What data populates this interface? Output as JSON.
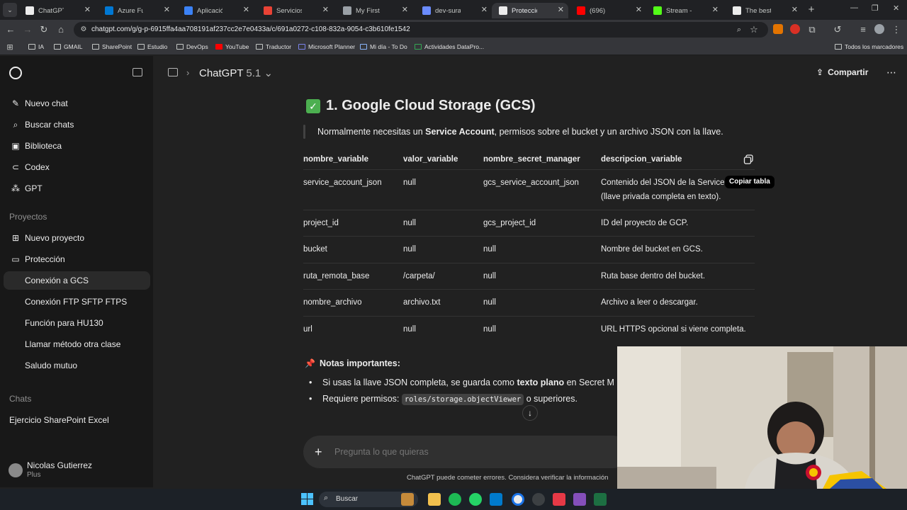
{
  "browser": {
    "tabs": [
      {
        "label": "ChatGPT",
        "color": "#ececec"
      },
      {
        "label": "Azure Functions",
        "color": "#0078d4"
      },
      {
        "label": "Aplicación de fun",
        "color": "#3b82f6"
      },
      {
        "label": "Servicios de com",
        "color": "#e94235"
      },
      {
        "label": "My First Project -",
        "color": "#9aa0a6"
      },
      {
        "label": "dev-sura-si-gold",
        "color": "#6b8cff"
      },
      {
        "label": "Protección - Con",
        "color": "#ececec"
      },
      {
        "label": "(696)",
        "color": "#ff0000"
      },
      {
        "label": "Stream - Kick Da",
        "color": "#53fc18"
      },
      {
        "label": "The best ChatBot",
        "color": "#ececec"
      }
    ],
    "url": "chatgpt.com/g/g-p-6915ffa4aa708191af237cc2e7e0433a/c/691a0272-c108-832a-9054-c3b610fe1542",
    "bookmarks": [
      "IA",
      "GMAIL",
      "SharePoint",
      "Estudio",
      "DevOps",
      "YouTube",
      "Traductor",
      "Microsoft Planner",
      "Mi día - To Do",
      "Actividades DataPro..."
    ],
    "all_bookmarks": "Todos los marcadores"
  },
  "sidebar": {
    "main_items": [
      {
        "label": "Nuevo chat",
        "icon": "edit-icon"
      },
      {
        "label": "Buscar chats",
        "icon": "search-icon"
      },
      {
        "label": "Biblioteca",
        "icon": "library-icon"
      },
      {
        "label": "Codex",
        "icon": "codex-icon"
      },
      {
        "label": "GPT",
        "icon": "gpt-icon"
      }
    ],
    "projects_heading": "Proyectos",
    "new_project": "Nuevo proyecto",
    "project": "Protección",
    "project_chats": [
      "Conexión a GCS",
      "Conexión FTP SFTP FTPS",
      "Función para HU130",
      "Llamar método otra clase",
      "Saludo mutuo"
    ],
    "chats_heading": "Chats",
    "chats": [
      "Ejercicio SharePoint Excel"
    ],
    "user": {
      "name": "Nicolas Gutierrez",
      "plan": "Plus"
    }
  },
  "header": {
    "model": "ChatGPT",
    "version": "5.1",
    "share_label": "Compartir"
  },
  "content": {
    "section_title": "1. Google Cloud Storage (GCS)",
    "quote_prefix": "Normalmente necesitas un ",
    "quote_bold": "Service Account",
    "quote_suffix": ", permisos sobre el bucket y un archivo JSON con la llave.",
    "table": {
      "headers": [
        "nombre_variable",
        "valor_variable",
        "nombre_secret_manager",
        "descripcion_variable"
      ],
      "rows": [
        [
          "service_account_json",
          "null",
          "gcs_service_account_json",
          "Contenido del JSON de la Service"
        ],
        [
          "project_id",
          "null",
          "gcs_project_id",
          "ID del proyecto de GCP."
        ],
        [
          "bucket",
          "null",
          "null",
          "Nombre del bucket en GCS."
        ],
        [
          "ruta_remota_base",
          "/carpeta/",
          "null",
          "Ruta base dentro del bucket."
        ],
        [
          "nombre_archivo",
          "archivo.txt",
          "null",
          "Archivo a leer o descargar."
        ],
        [
          "url",
          "null",
          "null",
          "URL HTTPS opcional si viene completa."
        ]
      ],
      "row0_line2": "(llave privada completa en texto).",
      "copy_tooltip": "Copiar tabla"
    },
    "notes_title": "Notas importantes:",
    "note1_prefix": "Si usas la llave JSON completa, se guarda como ",
    "note1_bold": "texto plano",
    "note1_suffix": " en Secret M",
    "note2_prefix": "Requiere permisos: ",
    "note2_code": "roles/storage.objectViewer",
    "note2_suffix": " o superiores."
  },
  "composer": {
    "placeholder": "Pregunta lo que quieras"
  },
  "disclaimer": "ChatGPT puede cometer errores. Considera verificar la información",
  "taskbar": {
    "search_label": "Buscar"
  }
}
